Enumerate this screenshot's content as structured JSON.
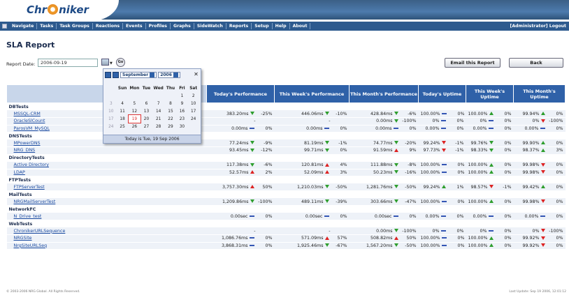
{
  "app": {
    "logo_text_a": "Chr",
    "logo_text_b": "niker"
  },
  "nav": {
    "items": [
      "Navigate",
      "Tasks",
      "Task Groups",
      "Reactions",
      "Events",
      "Profiles",
      "Graphs",
      "SideWatch",
      "Reports",
      "Setup",
      "Help",
      "About"
    ],
    "user_logout": "[Administrator] Logout"
  },
  "page": {
    "title": "SLA Report"
  },
  "report_date": {
    "label": "Report Date:",
    "value": "2006-09-19",
    "go_label": "Go"
  },
  "buttons": {
    "email": "Email this Report",
    "back": "Back"
  },
  "table": {
    "headers": [
      "Today's Performance",
      "This Week's Performance",
      "This Month's Performance",
      "Today's Uptime",
      "This Week's Uptime",
      "This Month's Uptime"
    ],
    "groups": [
      {
        "name": "DBTests",
        "rows": [
          {
            "name": "MSSQL-CRM",
            "tp": "383.20ms",
            "tpa": "down",
            "tpp": "-25%",
            "wp": "446.06ms",
            "wpa": "down",
            "wpp": "-10%",
            "mp": "428.84ms",
            "mpa": "down",
            "mpp": "-6%",
            "tu": "100.00%",
            "tua": "flat",
            "tup": "0%",
            "wu": "100.00%",
            "wua": "up",
            "wup": "0%",
            "mu": "99.94%",
            "mua": "up",
            "mup": "0%"
          },
          {
            "name": "OracleSlCount",
            "tp": "-",
            "tpa": "",
            "tpp": "",
            "wp": "-",
            "wpa": "",
            "wpp": "",
            "mp": "0.00ms",
            "mpa": "down",
            "mpp": "-100%",
            "tu": "0%",
            "tua": "flat",
            "tup": "0%",
            "wu": "0%",
            "wua": "flat",
            "wup": "0%",
            "mu": "0%",
            "mua": "downred",
            "mup": "-100%"
          },
          {
            "name": "ParosVM_MySQL",
            "tp": "0.00ms",
            "tpa": "flat",
            "tpp": "0%",
            "wp": "0.00ms",
            "wpa": "flat",
            "wpp": "0%",
            "mp": "0.00ms",
            "mpa": "flat",
            "mpp": "0%",
            "tu": "0.00%",
            "tua": "flat",
            "tup": "0%",
            "wu": "0.00%",
            "wua": "flat",
            "wup": "0%",
            "mu": "0.00%",
            "mua": "flat",
            "mup": "0%"
          }
        ]
      },
      {
        "name": "DNSTests",
        "rows": [
          {
            "name": "MPowerDNS",
            "tp": "77.24ms",
            "tpa": "down",
            "tpp": "-9%",
            "wp": "81.19ms",
            "wpa": "down",
            "wpp": "-1%",
            "mp": "74.77ms",
            "mpa": "down",
            "mpp": "-20%",
            "tu": "99.24%",
            "tua": "downred",
            "tup": "-1%",
            "wu": "99.76%",
            "wua": "down",
            "wup": "0%",
            "mu": "99.90%",
            "mua": "up",
            "mup": "0%"
          },
          {
            "name": "NRG_DNS",
            "tp": "93.45ms",
            "tpa": "down",
            "tpp": "-12%",
            "wp": "99.71ms",
            "wpa": "down",
            "wpp": "0%",
            "mp": "91.59ms",
            "mpa": "upred",
            "mpp": "9%",
            "tu": "97.73%",
            "tua": "downred",
            "tup": "-1%",
            "wu": "98.33%",
            "wua": "down",
            "wup": "0%",
            "mu": "98.37%",
            "mua": "up",
            "mup": "3%"
          }
        ]
      },
      {
        "name": "DirectoryTests",
        "rows": [
          {
            "name": "Active Directory",
            "tp": "117.38ms",
            "tpa": "down",
            "tpp": "-6%",
            "wp": "120.81ms",
            "wpa": "upred",
            "wpp": "4%",
            "mp": "111.88ms",
            "mpa": "down",
            "mpp": "-8%",
            "tu": "100.00%",
            "tua": "flat",
            "tup": "0%",
            "wu": "100.00%",
            "wua": "up",
            "wup": "0%",
            "mu": "99.98%",
            "mua": "downred",
            "mup": "0%"
          },
          {
            "name": "LDAP",
            "tp": "52.57ms",
            "tpa": "upred",
            "tpp": "2%",
            "wp": "52.09ms",
            "wpa": "upred",
            "wpp": "3%",
            "mp": "50.23ms",
            "mpa": "down",
            "mpp": "-16%",
            "tu": "100.00%",
            "tua": "flat",
            "tup": "0%",
            "wu": "100.00%",
            "wua": "up",
            "wup": "0%",
            "mu": "99.98%",
            "mua": "downred",
            "mup": "0%"
          }
        ]
      },
      {
        "name": "FTPTests",
        "rows": [
          {
            "name": "FTPServerTest",
            "tp": "3,757.30ms",
            "tpa": "upred",
            "tpp": "50%",
            "wp": "1,210.03ms",
            "wpa": "down",
            "wpp": "-50%",
            "mp": "1,281.76ms",
            "mpa": "down",
            "mpp": "-50%",
            "tu": "99.24%",
            "tua": "up",
            "tup": "1%",
            "wu": "98.57%",
            "wua": "downred",
            "wup": "-1%",
            "mu": "99.42%",
            "mua": "up",
            "mup": "0%"
          }
        ]
      },
      {
        "name": "MailTests",
        "rows": [
          {
            "name": "NRGMailServerTest",
            "tp": "1,209.86ms",
            "tpa": "down",
            "tpp": "-100%",
            "wp": "489.11ms",
            "wpa": "down",
            "wpp": "-39%",
            "mp": "303.66ms",
            "mpa": "down",
            "mpp": "-47%",
            "tu": "100.00%",
            "tua": "flat",
            "tup": "0%",
            "wu": "100.00%",
            "wua": "up",
            "wup": "0%",
            "mu": "99.98%",
            "mua": "downred",
            "mup": "0%"
          }
        ]
      },
      {
        "name": "NetworkFC",
        "rows": [
          {
            "name": "N_Drive_test",
            "tp": "0.00sec",
            "tpa": "flat",
            "tpp": "0%",
            "wp": "0.00sec",
            "wpa": "flat",
            "wpp": "0%",
            "mp": "0.00sec",
            "mpa": "flat",
            "mpp": "0%",
            "tu": "0.00%",
            "tua": "flat",
            "tup": "0%",
            "wu": "0.00%",
            "wua": "flat",
            "wup": "0%",
            "mu": "0.00%",
            "mua": "flat",
            "mup": "0%"
          }
        ]
      },
      {
        "name": "WebTests",
        "rows": [
          {
            "name": "ChronikerURLSequence",
            "tp": "-",
            "tpa": "",
            "tpp": "",
            "wp": "-",
            "wpa": "",
            "wpp": "",
            "mp": "0.00ms",
            "mpa": "down",
            "mpp": "-100%",
            "tu": "0%",
            "tua": "flat",
            "tup": "0%",
            "wu": "0%",
            "wua": "flat",
            "wup": "0%",
            "mu": "0%",
            "mua": "downred",
            "mup": "-100%"
          },
          {
            "name": "NRGSite",
            "tp": "1,086.76ms",
            "tpa": "flat",
            "tpp": "0%",
            "wp": "571.09ms",
            "wpa": "upred",
            "wpp": "57%",
            "mp": "508.82ms",
            "mpa": "upred",
            "mpp": "50%",
            "tu": "100.00%",
            "tua": "flat",
            "tup": "0%",
            "wu": "100.00%",
            "wua": "up",
            "wup": "0%",
            "mu": "99.92%",
            "mua": "downred",
            "mup": "0%"
          },
          {
            "name": "NrgSiteURLSeq",
            "tp": "3,868.31ms",
            "tpa": "flat",
            "tpp": "0%",
            "wp": "1,925.46ms",
            "wpa": "down",
            "wpp": "-67%",
            "mp": "1,567.20ms",
            "mpa": "down",
            "mpp": "-50%",
            "tu": "100.00%",
            "tua": "flat",
            "tup": "0%",
            "wu": "100.00%",
            "wua": "up",
            "wup": "0%",
            "mu": "99.92%",
            "mua": "downred",
            "mup": "0%"
          }
        ]
      }
    ]
  },
  "calendar": {
    "month": "September",
    "year": "2006",
    "close": "✕",
    "days": [
      "",
      "Sun",
      "Mon",
      "Tue",
      "Wed",
      "Thu",
      "Fri",
      "Sat"
    ],
    "weeks": [
      [
        "",
        "",
        "",
        "",
        "",
        "",
        "1",
        "2"
      ],
      [
        "3",
        "4",
        "5",
        "6",
        "7",
        "8",
        "9",
        "10"
      ],
      [
        "10",
        "11",
        "12",
        "13",
        "14",
        "15",
        "16",
        "17"
      ],
      [
        "17",
        "18",
        "19",
        "20",
        "21",
        "22",
        "23",
        "24"
      ],
      [
        "24",
        "25",
        "26",
        "27",
        "28",
        "29",
        "30",
        ""
      ]
    ],
    "today_text": "Today is Tue, 19 Sep 2006"
  },
  "footer": {
    "left": "© 2003-2006 NRG Global. All Rights Reserved.",
    "right": "Last Update: Sep 19 2006, 12:01:12"
  }
}
